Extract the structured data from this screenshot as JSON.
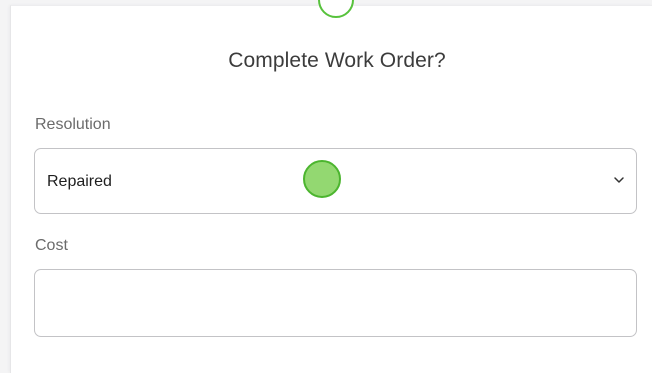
{
  "dialog": {
    "title": "Complete Work Order?",
    "top_icon": "status-circle-icon"
  },
  "resolution": {
    "label": "Resolution",
    "selected_value": "Repaired",
    "chevron_icon": "chevron-down-icon"
  },
  "cost": {
    "label": "Cost",
    "value": "",
    "placeholder": ""
  },
  "colors": {
    "accent_green": "#57c23c",
    "cursor_fill": "#93d871",
    "border": "#c3c3c6",
    "title_text": "#3c3c3c",
    "label_text": "#6b6b6b"
  }
}
